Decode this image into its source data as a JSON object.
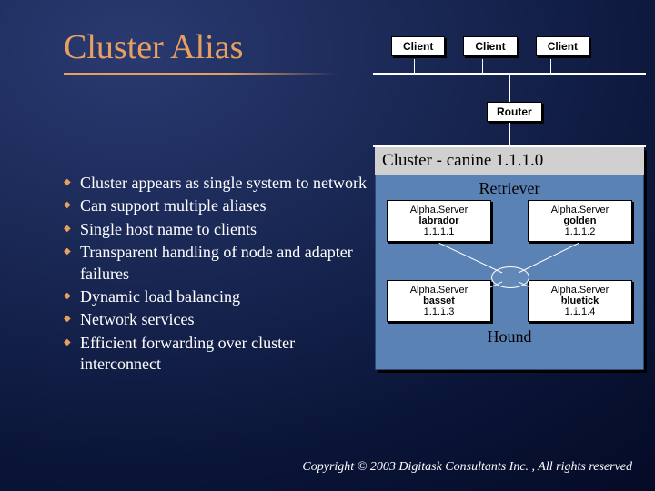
{
  "title": "Cluster Alias",
  "clients": [
    "Client",
    "Client",
    "Client"
  ],
  "router": "Router",
  "bullets": [
    "Cluster appears as single system to network",
    "Can support multiple aliases",
    "Single host name to clients",
    "Transparent handling of node and adapter failures",
    "Dynamic load balancing",
    "Network services",
    "Efficient forwarding over cluster interconnect"
  ],
  "cluster": {
    "title": "Cluster - canine 1.1.1.0",
    "group1_label": "Retriever",
    "group2_label": "Hound",
    "servers": [
      {
        "type": "Alpha.Server",
        "name": "labrador",
        "ip": "1.1.1.1"
      },
      {
        "type": "Alpha.Server",
        "name": "golden",
        "ip": "1.1.1.2"
      },
      {
        "type": "Alpha.Server",
        "name": "basset",
        "ip": "1.1.1.3"
      },
      {
        "type": "Alpha.Server",
        "name": "bluetick",
        "ip": "1.1.1.4"
      }
    ]
  },
  "copyright": "Copyright © 2003 Digitask Consultants Inc. , All rights reserved"
}
